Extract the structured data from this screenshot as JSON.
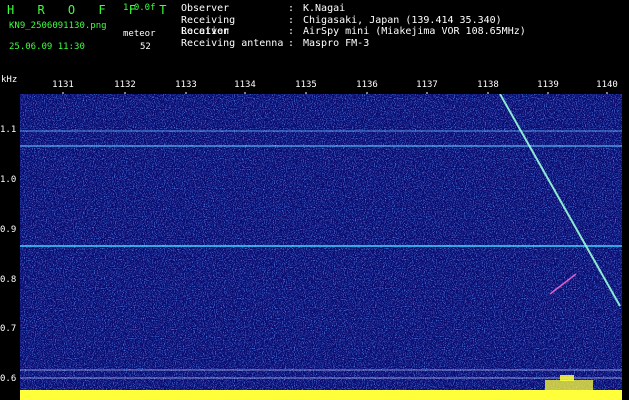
{
  "header": {
    "brand": "H R O F F T",
    "version": "1.0.0f",
    "filename": "KN9_2506091130.png",
    "datetime": "25.06.09 11:30",
    "meteor_label": "meteor",
    "meteor_count": "52",
    "fields": [
      {
        "key": "Observer",
        "value": "K.Nagai"
      },
      {
        "key": "Receiving Location",
        "value": "Chigasaki, Japan (139.414 35.340)"
      },
      {
        "key": "Receiver",
        "value": "AirSpy mini (Miakejima VOR 108.65MHz)"
      },
      {
        "key": "Receiving antenna",
        "value": "Maspro FM-3"
      }
    ]
  },
  "spectrogram": {
    "y_unit": "kHz",
    "x_ticks": [
      "1131",
      "1132",
      "1133",
      "1134",
      "1135",
      "1136",
      "1137",
      "1138",
      "1139",
      "1140"
    ],
    "y_ticks": [
      "1.1",
      "1.0",
      "0.9",
      "0.8",
      "0.7",
      "0.6"
    ],
    "colors": {
      "background": "#0a0a6e",
      "carrier_line": "#3fd7ff",
      "meteor_trail": "#9affd8",
      "ambient_bar": "#ffff3a"
    }
  }
}
